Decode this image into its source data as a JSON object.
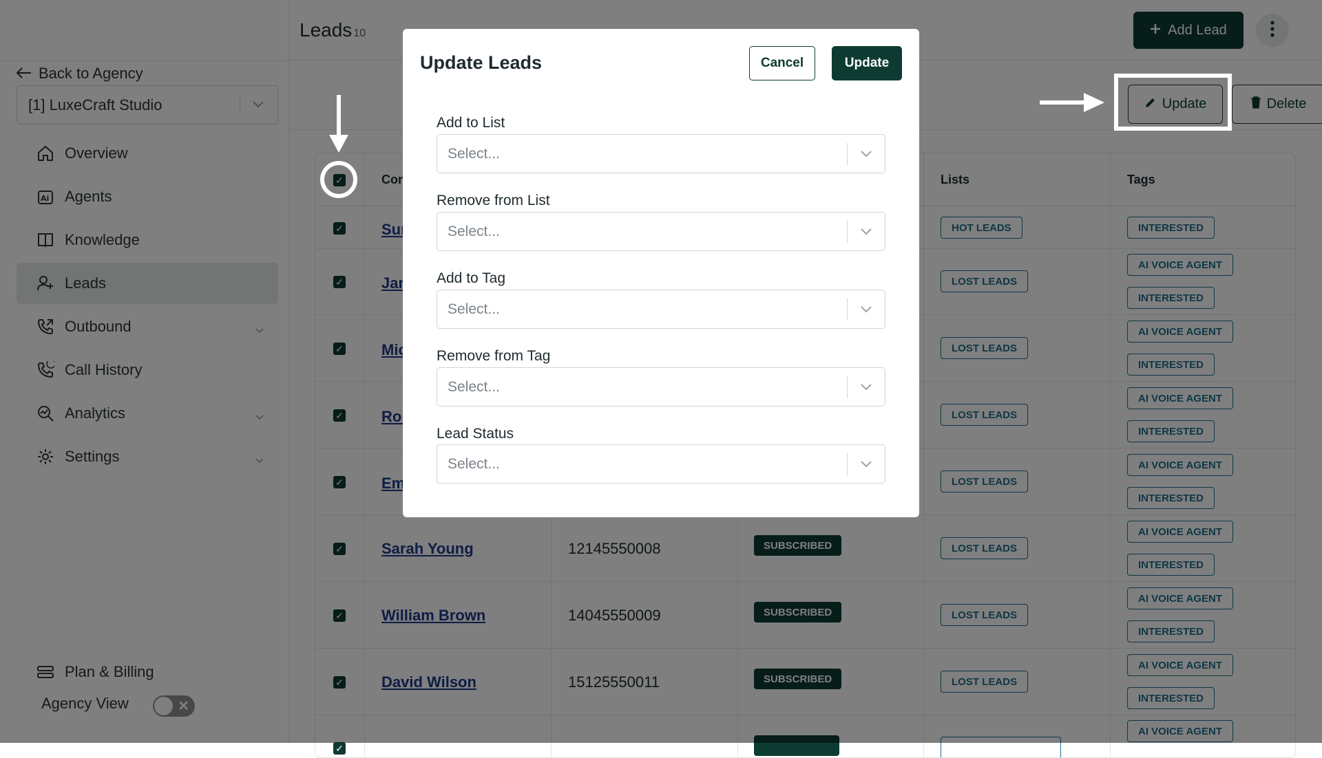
{
  "sidebar": {
    "back_label": "Back to Agency",
    "agency_selected": "[1] LuxeCraft Studio",
    "nav": [
      {
        "label": "Overview",
        "icon": "home-icon"
      },
      {
        "label": "Agents",
        "icon": "ai-agent-icon"
      },
      {
        "label": "Knowledge",
        "icon": "book-icon"
      },
      {
        "label": "Leads",
        "icon": "user-plus-icon",
        "active": true
      },
      {
        "label": "Outbound",
        "icon": "phone-outgoing-icon",
        "has_submenu": true
      },
      {
        "label": "Call History",
        "icon": "phone-history-icon"
      },
      {
        "label": "Analytics",
        "icon": "analytics-icon",
        "has_submenu": true
      },
      {
        "label": "Settings",
        "icon": "gear-icon",
        "has_submenu": true
      }
    ],
    "plan_billing_label": "Plan & Billing",
    "agency_view_label": "Agency View"
  },
  "header": {
    "title": "Leads",
    "count": "10",
    "add_lead_label": "Add Lead"
  },
  "toolbar": {
    "update_label": "Update",
    "delete_label": "Delete"
  },
  "table": {
    "columns": [
      "Con",
      "Lists",
      "Tags"
    ],
    "rows": [
      {
        "name": "Sur",
        "list": "HOT LEADS",
        "tags": [
          "INTERESTED"
        ]
      },
      {
        "name": "Jan",
        "list": "LOST LEADS",
        "tags": [
          "AI VOICE AGENT",
          "INTERESTED"
        ]
      },
      {
        "name": "Mic",
        "list": "LOST LEADS",
        "tags": [
          "AI VOICE AGENT",
          "INTERESTED"
        ]
      },
      {
        "name": "Rol",
        "list": "LOST LEADS",
        "tags": [
          "AI VOICE AGENT",
          "INTERESTED"
        ]
      },
      {
        "name": "Em",
        "list": "LOST LEADS",
        "tags": [
          "AI VOICE AGENT",
          "INTERESTED"
        ]
      },
      {
        "name": "Sarah Young",
        "phone": "12145550008",
        "status": "SUBSCRIBED",
        "list": "LOST LEADS",
        "tags": [
          "AI VOICE AGENT",
          "INTERESTED"
        ]
      },
      {
        "name": "William Brown",
        "phone": "14045550009",
        "status": "SUBSCRIBED",
        "list": "LOST LEADS",
        "tags": [
          "AI VOICE AGENT",
          "INTERESTED"
        ]
      },
      {
        "name": "David Wilson",
        "phone": "15125550011",
        "status": "SUBSCRIBED",
        "list": "LOST LEADS",
        "tags": [
          "AI VOICE AGENT",
          "INTERESTED"
        ]
      }
    ],
    "partial_last_row_tag": "AI VOICE AGENT"
  },
  "modal": {
    "title": "Update Leads",
    "cancel_label": "Cancel",
    "update_label": "Update",
    "fields": [
      {
        "label": "Add to List",
        "placeholder": "Select..."
      },
      {
        "label": "Remove from List",
        "placeholder": "Select..."
      },
      {
        "label": "Add to Tag",
        "placeholder": "Select..."
      },
      {
        "label": "Remove from Tag",
        "placeholder": "Select..."
      },
      {
        "label": "Lead Status",
        "placeholder": "Select..."
      }
    ]
  },
  "colors": {
    "primary": "#0d3b32",
    "tag": "#1f6f8a",
    "link": "#1e3a8a"
  }
}
